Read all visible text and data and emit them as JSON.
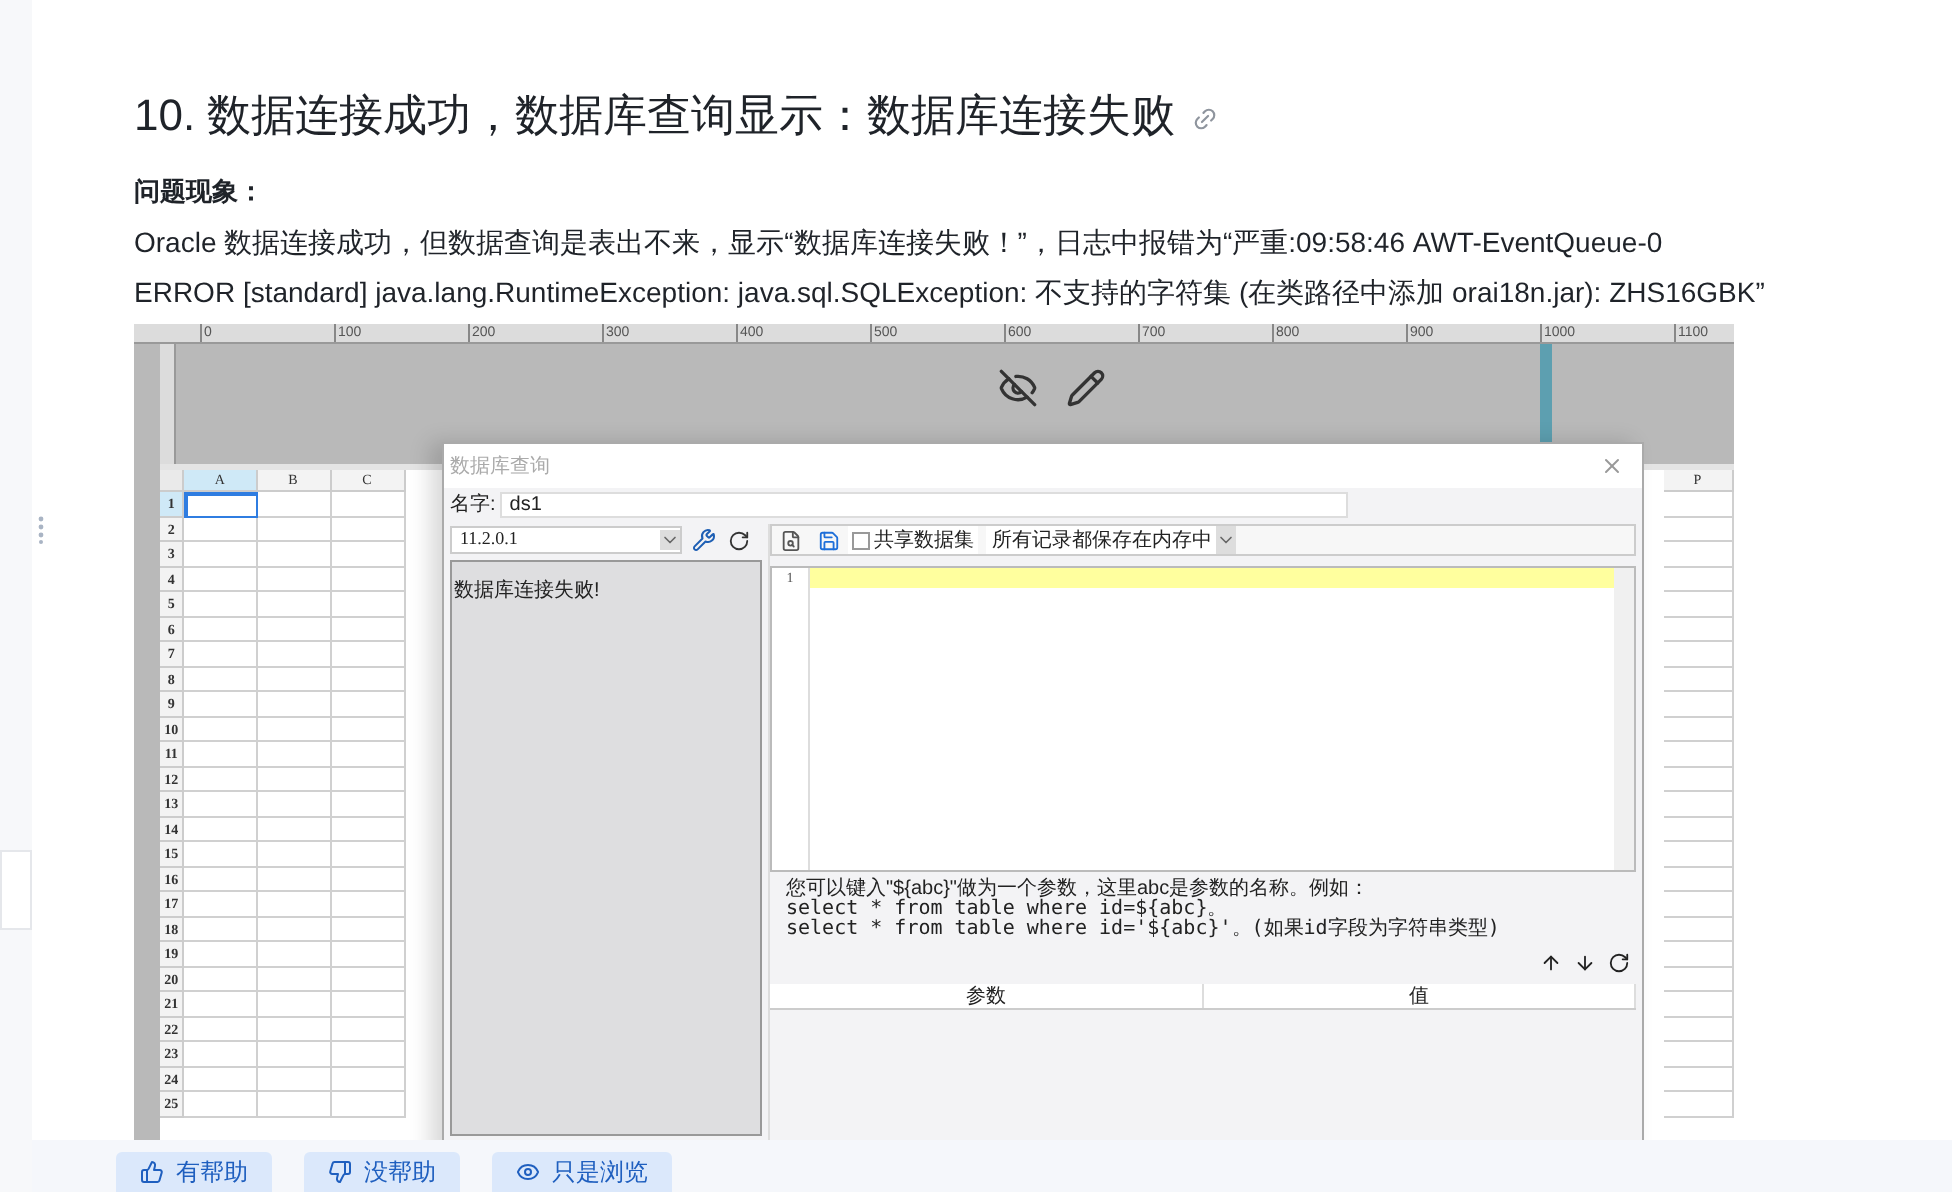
{
  "heading": "10. 数据连接成功，数据库查询显示：数据库连接失败",
  "section_label": "问题现象：",
  "paragraph_lines": [
    "Oracle 数据连接成功，但数据查询是表出不来，显示“数据库连接失败！”，日志中报错为“严重:09:58:46 AWT-EventQueue-0",
    "ERROR [standard] java.lang.RuntimeException: java.sql.SQLException: 不支持的字符集 (在类路径中添加 orai18n.jar): ZHS16GBK”"
  ],
  "screenshot": {
    "ruler_labels": [
      "0",
      "100",
      "200",
      "300",
      "400",
      "500",
      "600",
      "700",
      "800",
      "900",
      "1000",
      "1100"
    ],
    "columns": [
      {
        "label": "A",
        "selected": true
      },
      {
        "label": "B",
        "selected": false
      },
      {
        "label": "C",
        "selected": false
      },
      {
        "label": "P",
        "selected": false
      }
    ],
    "rows": [
      "1",
      "2",
      "3",
      "4",
      "5",
      "6",
      "7",
      "8",
      "9",
      "10",
      "11",
      "12",
      "13",
      "14",
      "15",
      "16",
      "17",
      "18",
      "19",
      "20",
      "21",
      "22",
      "23",
      "24",
      "25"
    ],
    "dialog": {
      "title": "数据库查询",
      "name_label": "名字:",
      "name_value": "ds1",
      "connection": "11.2.0.1",
      "error_text": "数据库连接失败!",
      "share_label": "共享数据集",
      "share_checked": false,
      "memory_option": "所有记录都保存在内存中",
      "line_numbers": [
        "1"
      ],
      "hint_lines": [
        "您可以键入\"${abc}\"做为一个参数，这里abc是参数的名称。例如：",
        "select * from table where id=${abc}。",
        "select * from table where id='${abc}'。(如果id字段为字符串类型)"
      ],
      "param_columns": [
        "参数",
        "值"
      ]
    }
  },
  "feedback_buttons": [
    "有帮助",
    "没帮助",
    "只是浏览"
  ]
}
